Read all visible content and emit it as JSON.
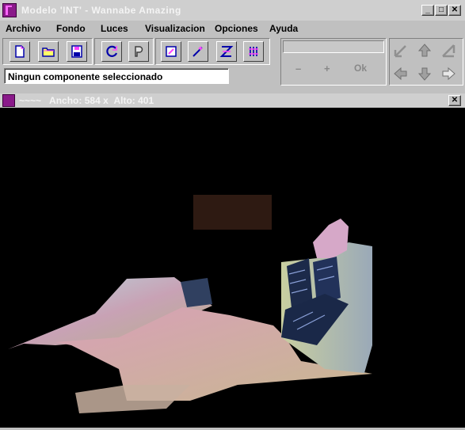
{
  "window": {
    "title": "Modelo  'INT' -  Wannabe Amazing"
  },
  "menu": [
    "Archivo",
    "Fondo",
    "Luces",
    "Visualizacion",
    "Opciones",
    "Ayuda"
  ],
  "toolbar": {
    "group1": [
      "new-file-icon",
      "open-folder-icon",
      "save-icon"
    ],
    "group2": [
      "refresh-icon",
      "p-icon"
    ],
    "group3": [
      "paint-icon",
      "wand-icon",
      "move-icon",
      "grid-icon"
    ]
  },
  "status": {
    "text": "Ningun componente seleccionado"
  },
  "panel": {
    "minus": "–",
    "plus": "+",
    "ok": "Ok"
  },
  "view": {
    "name": "~~~~",
    "width_label": "Ancho:",
    "width": "584",
    "x": "x",
    "height_label": "Alto:",
    "height": "401"
  },
  "colors": {
    "title_bar": "#cfcfcf",
    "face": "#c0c0c0",
    "viewport": "#000000"
  }
}
